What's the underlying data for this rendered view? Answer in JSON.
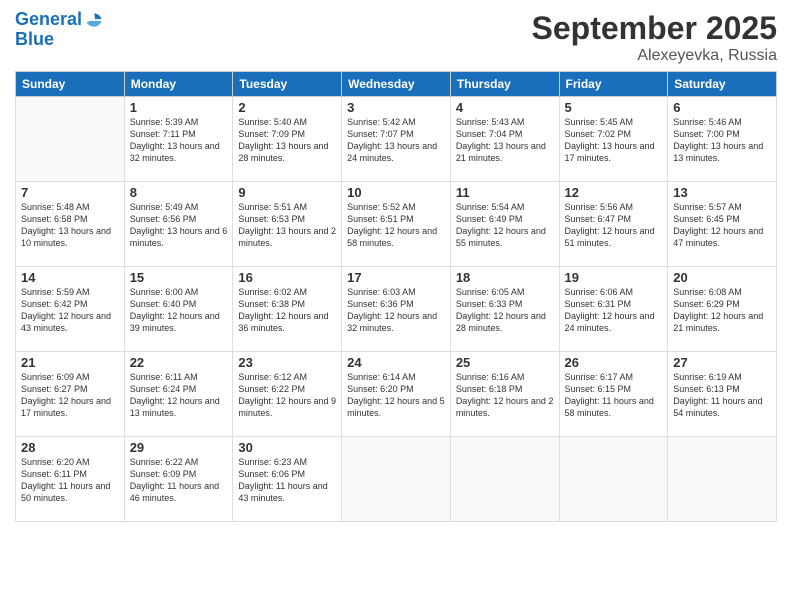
{
  "header": {
    "logo_line1": "General",
    "logo_line2": "Blue",
    "month": "September 2025",
    "location": "Alexeyevka, Russia"
  },
  "weekdays": [
    "Sunday",
    "Monday",
    "Tuesday",
    "Wednesday",
    "Thursday",
    "Friday",
    "Saturday"
  ],
  "weeks": [
    [
      {
        "day": "",
        "info": ""
      },
      {
        "day": "1",
        "info": "Sunrise: 5:39 AM\nSunset: 7:11 PM\nDaylight: 13 hours\nand 32 minutes."
      },
      {
        "day": "2",
        "info": "Sunrise: 5:40 AM\nSunset: 7:09 PM\nDaylight: 13 hours\nand 28 minutes."
      },
      {
        "day": "3",
        "info": "Sunrise: 5:42 AM\nSunset: 7:07 PM\nDaylight: 13 hours\nand 24 minutes."
      },
      {
        "day": "4",
        "info": "Sunrise: 5:43 AM\nSunset: 7:04 PM\nDaylight: 13 hours\nand 21 minutes."
      },
      {
        "day": "5",
        "info": "Sunrise: 5:45 AM\nSunset: 7:02 PM\nDaylight: 13 hours\nand 17 minutes."
      },
      {
        "day": "6",
        "info": "Sunrise: 5:46 AM\nSunset: 7:00 PM\nDaylight: 13 hours\nand 13 minutes."
      }
    ],
    [
      {
        "day": "7",
        "info": "Sunrise: 5:48 AM\nSunset: 6:58 PM\nDaylight: 13 hours\nand 10 minutes."
      },
      {
        "day": "8",
        "info": "Sunrise: 5:49 AM\nSunset: 6:56 PM\nDaylight: 13 hours\nand 6 minutes."
      },
      {
        "day": "9",
        "info": "Sunrise: 5:51 AM\nSunset: 6:53 PM\nDaylight: 13 hours\nand 2 minutes."
      },
      {
        "day": "10",
        "info": "Sunrise: 5:52 AM\nSunset: 6:51 PM\nDaylight: 12 hours\nand 58 minutes."
      },
      {
        "day": "11",
        "info": "Sunrise: 5:54 AM\nSunset: 6:49 PM\nDaylight: 12 hours\nand 55 minutes."
      },
      {
        "day": "12",
        "info": "Sunrise: 5:56 AM\nSunset: 6:47 PM\nDaylight: 12 hours\nand 51 minutes."
      },
      {
        "day": "13",
        "info": "Sunrise: 5:57 AM\nSunset: 6:45 PM\nDaylight: 12 hours\nand 47 minutes."
      }
    ],
    [
      {
        "day": "14",
        "info": "Sunrise: 5:59 AM\nSunset: 6:42 PM\nDaylight: 12 hours\nand 43 minutes."
      },
      {
        "day": "15",
        "info": "Sunrise: 6:00 AM\nSunset: 6:40 PM\nDaylight: 12 hours\nand 39 minutes."
      },
      {
        "day": "16",
        "info": "Sunrise: 6:02 AM\nSunset: 6:38 PM\nDaylight: 12 hours\nand 36 minutes."
      },
      {
        "day": "17",
        "info": "Sunrise: 6:03 AM\nSunset: 6:36 PM\nDaylight: 12 hours\nand 32 minutes."
      },
      {
        "day": "18",
        "info": "Sunrise: 6:05 AM\nSunset: 6:33 PM\nDaylight: 12 hours\nand 28 minutes."
      },
      {
        "day": "19",
        "info": "Sunrise: 6:06 AM\nSunset: 6:31 PM\nDaylight: 12 hours\nand 24 minutes."
      },
      {
        "day": "20",
        "info": "Sunrise: 6:08 AM\nSunset: 6:29 PM\nDaylight: 12 hours\nand 21 minutes."
      }
    ],
    [
      {
        "day": "21",
        "info": "Sunrise: 6:09 AM\nSunset: 6:27 PM\nDaylight: 12 hours\nand 17 minutes."
      },
      {
        "day": "22",
        "info": "Sunrise: 6:11 AM\nSunset: 6:24 PM\nDaylight: 12 hours\nand 13 minutes."
      },
      {
        "day": "23",
        "info": "Sunrise: 6:12 AM\nSunset: 6:22 PM\nDaylight: 12 hours\nand 9 minutes."
      },
      {
        "day": "24",
        "info": "Sunrise: 6:14 AM\nSunset: 6:20 PM\nDaylight: 12 hours\nand 5 minutes."
      },
      {
        "day": "25",
        "info": "Sunrise: 6:16 AM\nSunset: 6:18 PM\nDaylight: 12 hours\nand 2 minutes."
      },
      {
        "day": "26",
        "info": "Sunrise: 6:17 AM\nSunset: 6:15 PM\nDaylight: 11 hours\nand 58 minutes."
      },
      {
        "day": "27",
        "info": "Sunrise: 6:19 AM\nSunset: 6:13 PM\nDaylight: 11 hours\nand 54 minutes."
      }
    ],
    [
      {
        "day": "28",
        "info": "Sunrise: 6:20 AM\nSunset: 6:11 PM\nDaylight: 11 hours\nand 50 minutes."
      },
      {
        "day": "29",
        "info": "Sunrise: 6:22 AM\nSunset: 6:09 PM\nDaylight: 11 hours\nand 46 minutes."
      },
      {
        "day": "30",
        "info": "Sunrise: 6:23 AM\nSunset: 6:06 PM\nDaylight: 11 hours\nand 43 minutes."
      },
      {
        "day": "",
        "info": ""
      },
      {
        "day": "",
        "info": ""
      },
      {
        "day": "",
        "info": ""
      },
      {
        "day": "",
        "info": ""
      }
    ]
  ]
}
